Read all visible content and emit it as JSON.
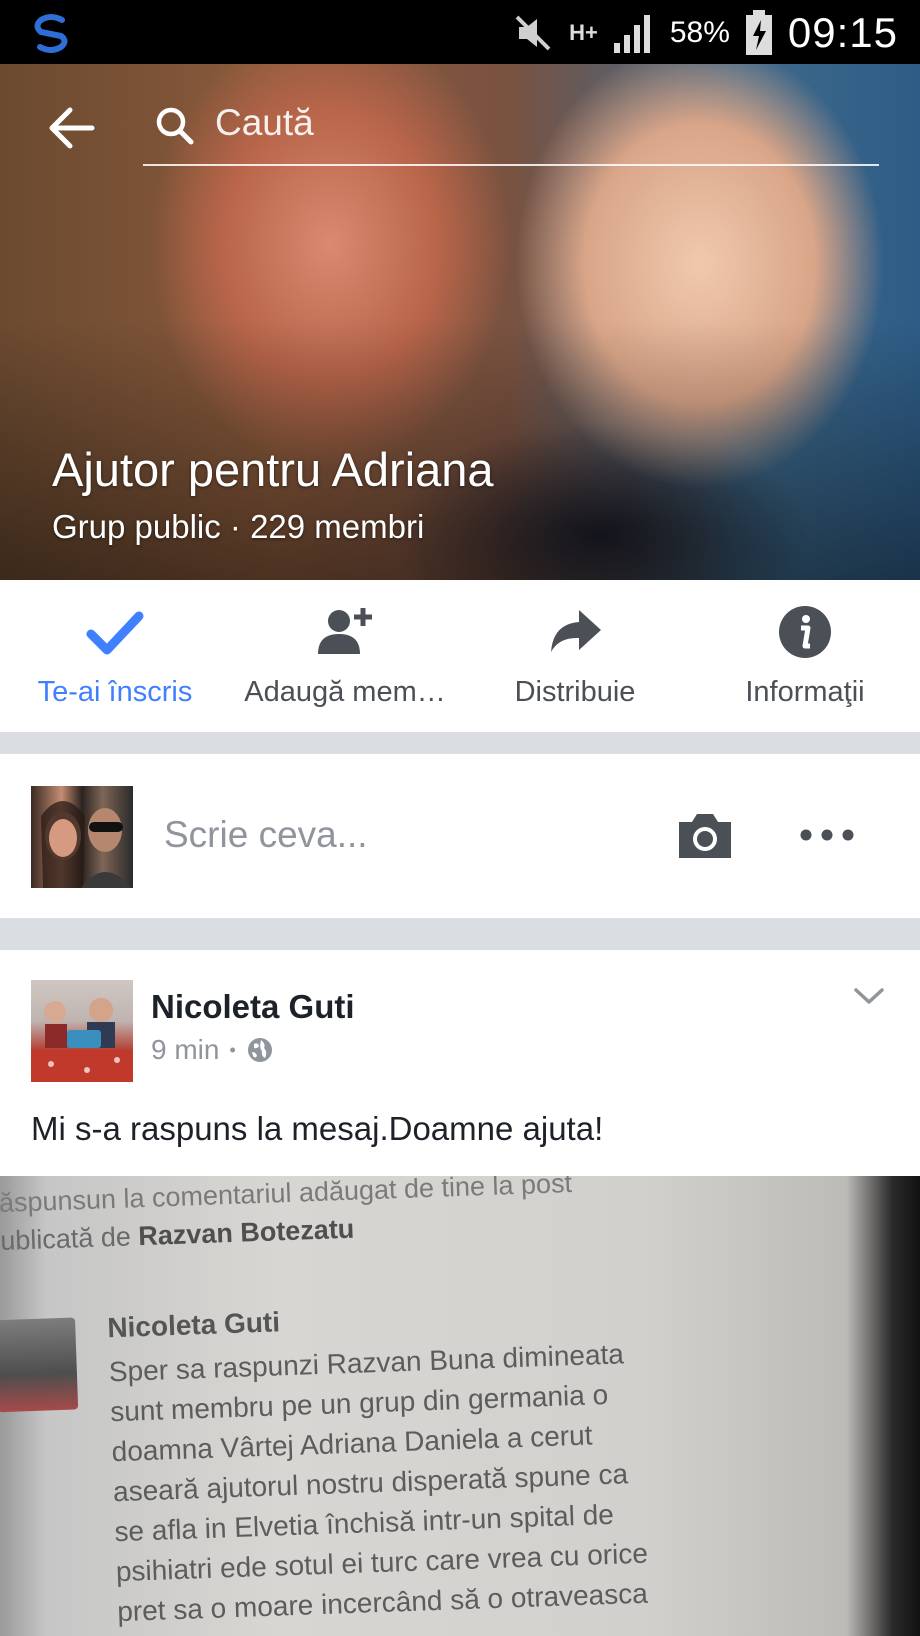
{
  "status_bar": {
    "network": "H+",
    "battery": "58%",
    "time": "09:15"
  },
  "search": {
    "placeholder": "Caută"
  },
  "group": {
    "title": "Ajutor pentru Adriana",
    "subtitle": "Grup public · 229 membri"
  },
  "actions": [
    {
      "label": "Te-ai înscris",
      "icon": "checkmark-icon"
    },
    {
      "label": "Adaugă mem…",
      "icon": "add-person-icon"
    },
    {
      "label": "Distribuie",
      "icon": "share-arrow-icon"
    },
    {
      "label": "Informaţii",
      "icon": "info-icon"
    }
  ],
  "composer": {
    "placeholder": "Scrie ceva..."
  },
  "post": {
    "author": "Nicoleta Guti",
    "time": "9 min",
    "separator": "•",
    "text": "Mi s-a raspuns la mesaj.Doamne ajuta!",
    "image_text": {
      "line1": "ăspunsun la comentariul adăugat de tine la post",
      "line2_prefix": "ublicată de",
      "line2_name": "Razvan Botezatu",
      "commenter": "Nicoleta Guti",
      "lines": [
        "Sper sa raspunzi Razvan  Buna dimineata",
        "sunt membru pe un grup din germania   o",
        "doamna Vârtej Adriana Daniela  a cerut",
        "aseară ajutorul nostru disperată spune ca",
        "se afla in Elvetia închisă intr-un spital de",
        "psihiatri ede sotul ei turc care vrea cu orice",
        "pret sa o moare incercând să o otraveasca"
      ]
    }
  },
  "colors": {
    "accent": "#4080ff",
    "icon_gray": "#4b4f56",
    "divider": "#dadde1",
    "secondary_text": "#90949c"
  }
}
